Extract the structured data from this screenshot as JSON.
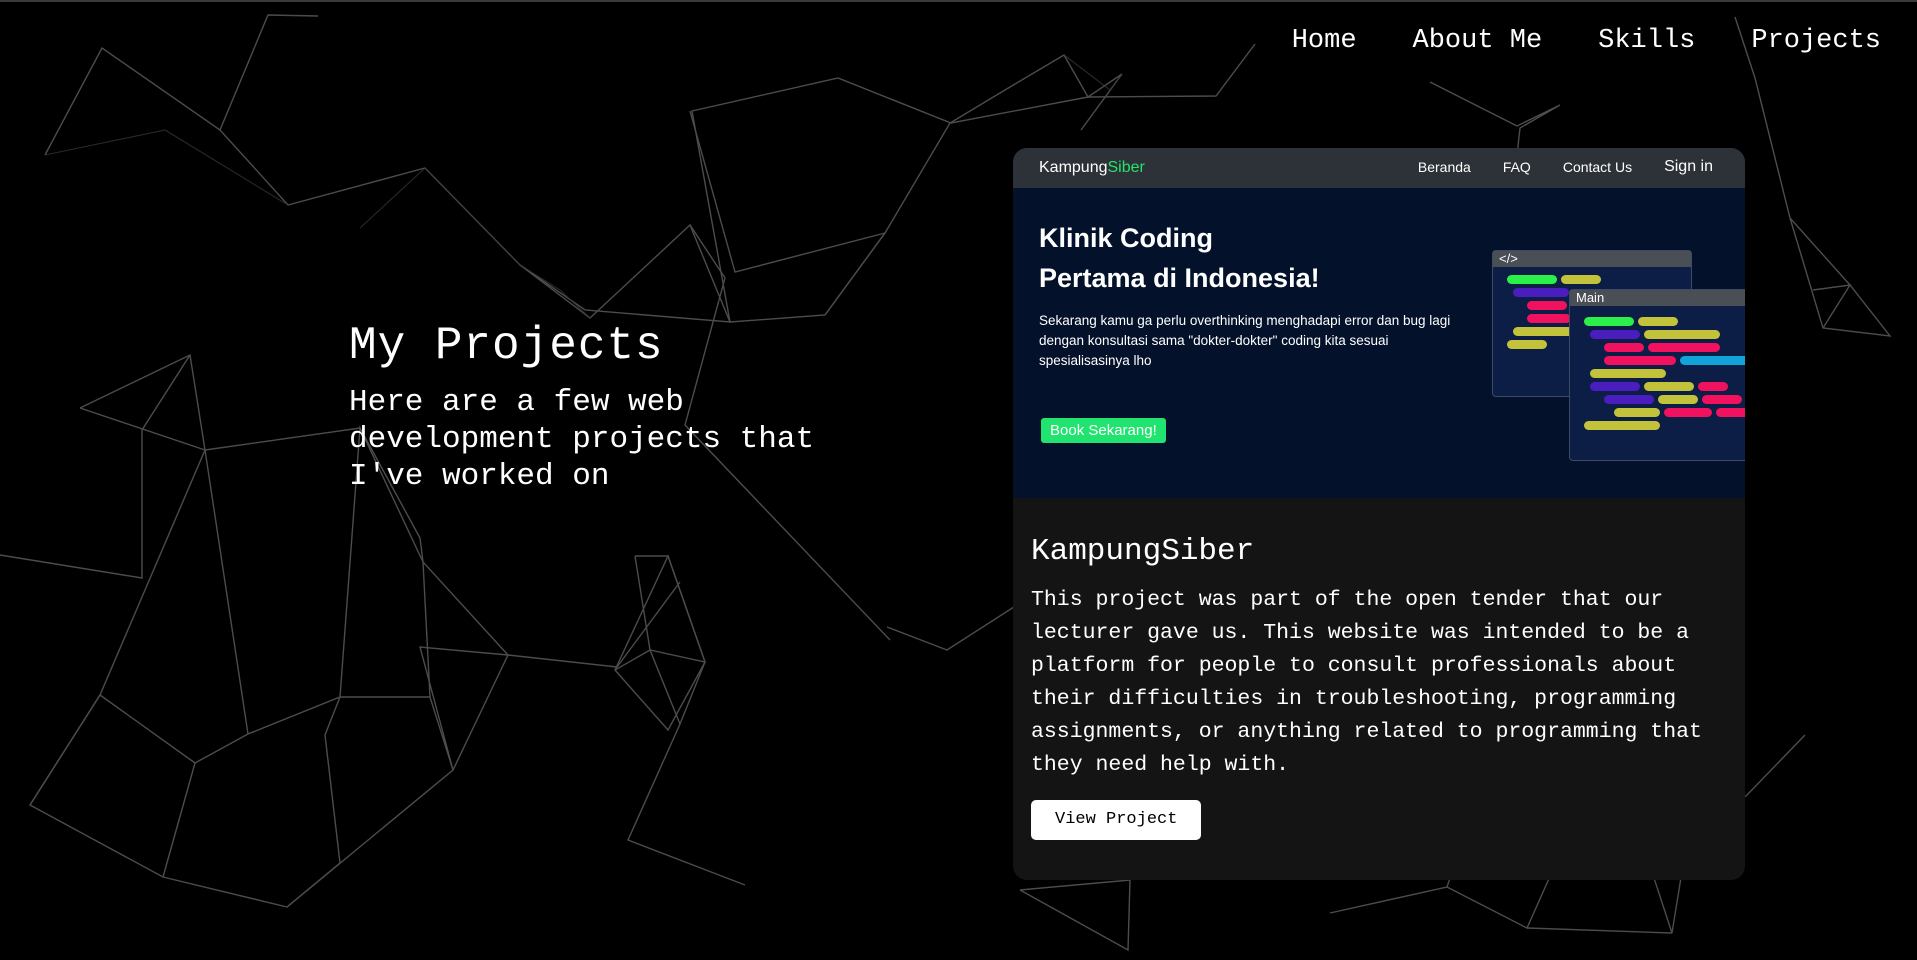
{
  "nav": {
    "home": "Home",
    "about": "About Me",
    "skills": "Skills",
    "projects": "Projects"
  },
  "intro": {
    "title": "My Projects",
    "subtitle": "Here are a few web development projects that I've worked on"
  },
  "project": {
    "name": "KampungSiber",
    "description": "This project was part of the open tender that our lecturer gave us. This website was intended to be a platform for people to consult professionals about their difficulties in troubleshooting, programming assignments, or anything related to programming that they need help with.",
    "button": "View Project",
    "screenshot": {
      "brand_main": "Kampung",
      "brand_accent": "Siber",
      "nav": [
        "Beranda",
        "FAQ",
        "Contact Us",
        "Sign in"
      ],
      "headline_line1": "Klinik Coding",
      "headline_line2": "Pertama di Indonesia!",
      "description": "Sekarang kamu ga perlu overthinking menghadapi error dan bug lagi dengan konsultasi sama \"dokter-dokter\" coding kita sesuai spesialisasinya lho",
      "cta": "Book Sekarang!",
      "code_icon": "</>",
      "code_window_label": "Main"
    }
  },
  "colors": {
    "background": "#000000",
    "card": "#141414",
    "accent_green": "#27e36a",
    "screenshot_bg": "#03112a"
  }
}
